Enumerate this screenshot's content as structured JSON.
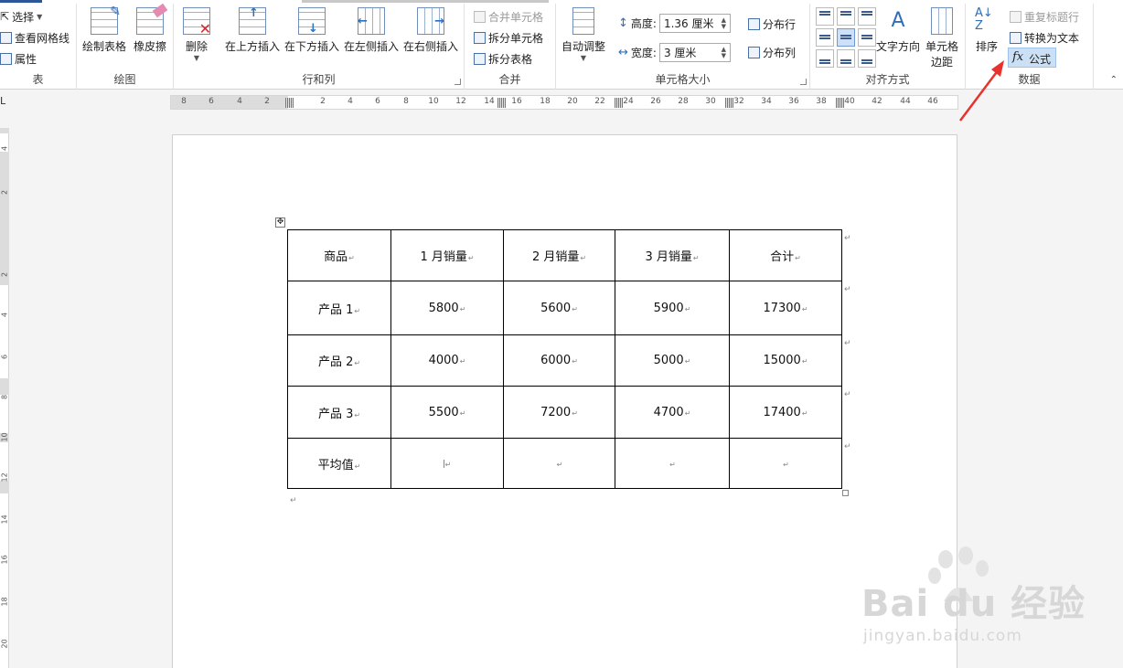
{
  "ribbon": {
    "table_group": {
      "select": "选择",
      "view_gridlines": "查看网格线",
      "properties": "属性",
      "label": "表"
    },
    "draw_group": {
      "draw_table": "绘制表格",
      "eraser": "橡皮擦",
      "label": "绘图"
    },
    "rows_cols_group": {
      "delete": "删除",
      "insert_above": "在上方插入",
      "insert_below": "在下方插入",
      "insert_left": "在左侧插入",
      "insert_right": "在右侧插入",
      "label": "行和列"
    },
    "merge_group": {
      "merge_cells": "合并单元格",
      "split_cells": "拆分单元格",
      "split_table": "拆分表格",
      "label": "合并"
    },
    "cell_size_group": {
      "autofit": "自动调整",
      "height_label": "高度:",
      "height_value": "1.36 厘米",
      "width_label": "宽度:",
      "width_value": "3 厘米",
      "distribute_rows": "分布行",
      "distribute_cols": "分布列",
      "label": "单元格大小"
    },
    "alignment_group": {
      "text_direction": "文字方向",
      "cell_margins_line1": "单元格",
      "cell_margins_line2": "边距",
      "label": "对齐方式"
    },
    "data_group": {
      "sort": "排序",
      "repeat_header": "重复标题行",
      "convert_to_text": "转换为文本",
      "formula_icon": "fx",
      "formula": "公式",
      "label": "数据"
    }
  },
  "ruler": {
    "ticks": [
      "8",
      "6",
      "4",
      "2",
      "2",
      "4",
      "6",
      "8",
      "10",
      "12",
      "14",
      "16",
      "18",
      "20",
      "22",
      "24",
      "26",
      "28",
      "30",
      "32",
      "34",
      "36",
      "38",
      "40",
      "42",
      "44",
      "46"
    ],
    "corner": "L"
  },
  "vruler": {
    "ticks": [
      "4",
      "2",
      "2",
      "4",
      "6",
      "8",
      "10",
      "12",
      "14",
      "16",
      "18",
      "20"
    ]
  },
  "table": {
    "header": [
      "商品",
      "1 月销量",
      "2 月销量",
      "3 月销量",
      "合计"
    ],
    "rows": [
      [
        "产品 1",
        "5800",
        "5600",
        "5900",
        "17300"
      ],
      [
        "产品 2",
        "4000",
        "6000",
        "5000",
        "15000"
      ],
      [
        "产品 3",
        "5500",
        "7200",
        "4700",
        "17400"
      ],
      [
        "平均值",
        "",
        "",
        "",
        ""
      ]
    ],
    "paragraph_mark": "↵"
  },
  "watermark": {
    "brand": "Bai du 经验",
    "url": "jingyan.baidu.com"
  },
  "colors": {
    "accent": "#2b579a",
    "selection": "#cce0f5",
    "annotation_arrow": "#e8322e"
  }
}
